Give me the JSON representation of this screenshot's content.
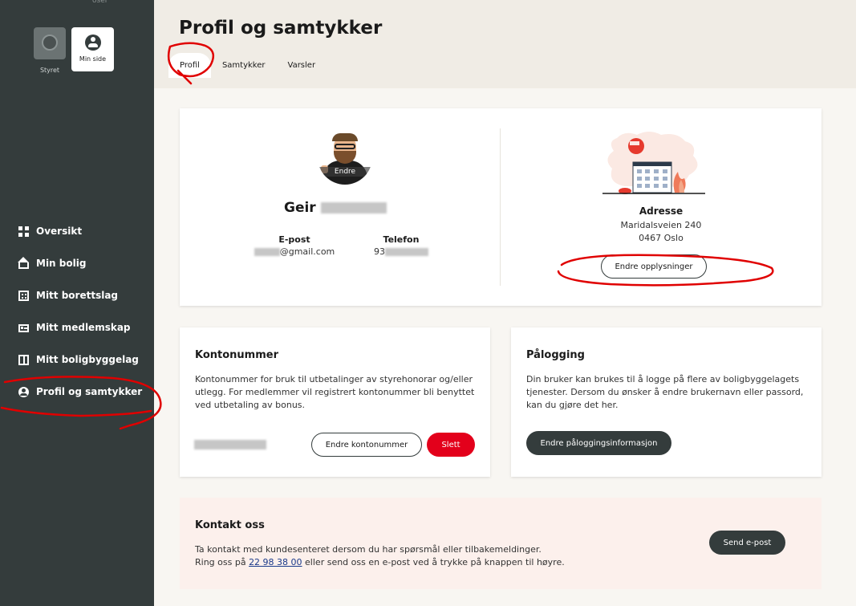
{
  "sidebar": {
    "topline": "oser",
    "switcher": [
      {
        "label": "Styret"
      },
      {
        "label": "Min side"
      }
    ],
    "items": [
      {
        "label": "Oversikt",
        "icon": "grid-icon"
      },
      {
        "label": "Min bolig",
        "icon": "house-icon"
      },
      {
        "label": "Mitt borettslag",
        "icon": "building-icon"
      },
      {
        "label": "Mitt medlemskap",
        "icon": "card-icon"
      },
      {
        "label": "Mitt boligbyggelag",
        "icon": "blocks-icon"
      },
      {
        "label": "Profil og samtykker",
        "icon": "user-icon",
        "active": true
      }
    ]
  },
  "header": {
    "title": "Profil og samtykker",
    "tabs": [
      {
        "label": "Profil",
        "active": true
      },
      {
        "label": "Samtykker"
      },
      {
        "label": "Varsler"
      }
    ]
  },
  "profile": {
    "avatar_edit": "Endre",
    "first_name": "Geir",
    "email_label": "E-post",
    "email_value": "@gmail.com",
    "phone_label": "Telefon",
    "phone_value": "93"
  },
  "address": {
    "title": "Adresse",
    "line1": "Maridalsveien 240",
    "line2": "0467 Oslo",
    "button": "Endre opplysninger"
  },
  "kontonummer": {
    "title": "Kontonummer",
    "text": "Kontonummer for bruk til utbetalinger av styrehonorar og/eller utlegg. For medlemmer vil registrert kontonummer bli benyttet ved utbetaling av bonus.",
    "edit_button": "Endre kontonummer",
    "delete_button": "Slett"
  },
  "palogging": {
    "title": "Pålogging",
    "text": "Din bruker kan brukes til å logge på flere av boligbyggelagets tjenester. Dersom du ønsker å endre brukernavn eller passord, kan du gjøre det her.",
    "button": "Endre påloggingsinformasjon"
  },
  "kontakt": {
    "title": "Kontakt oss",
    "line1": "Ta kontakt med kundesenteret dersom du har spørsmål eller tilbakemeldinger.",
    "line2_pre": "Ring oss på ",
    "phone": "22 98 38 00",
    "line2_post": " eller send oss en e-post ved å trykke på knappen til høyre.",
    "button": "Send e-post"
  },
  "colors": {
    "sidebar_bg": "#343c3c",
    "header_bg": "#f0ece5",
    "danger": "#e3001b",
    "annotation": "#e00000"
  }
}
